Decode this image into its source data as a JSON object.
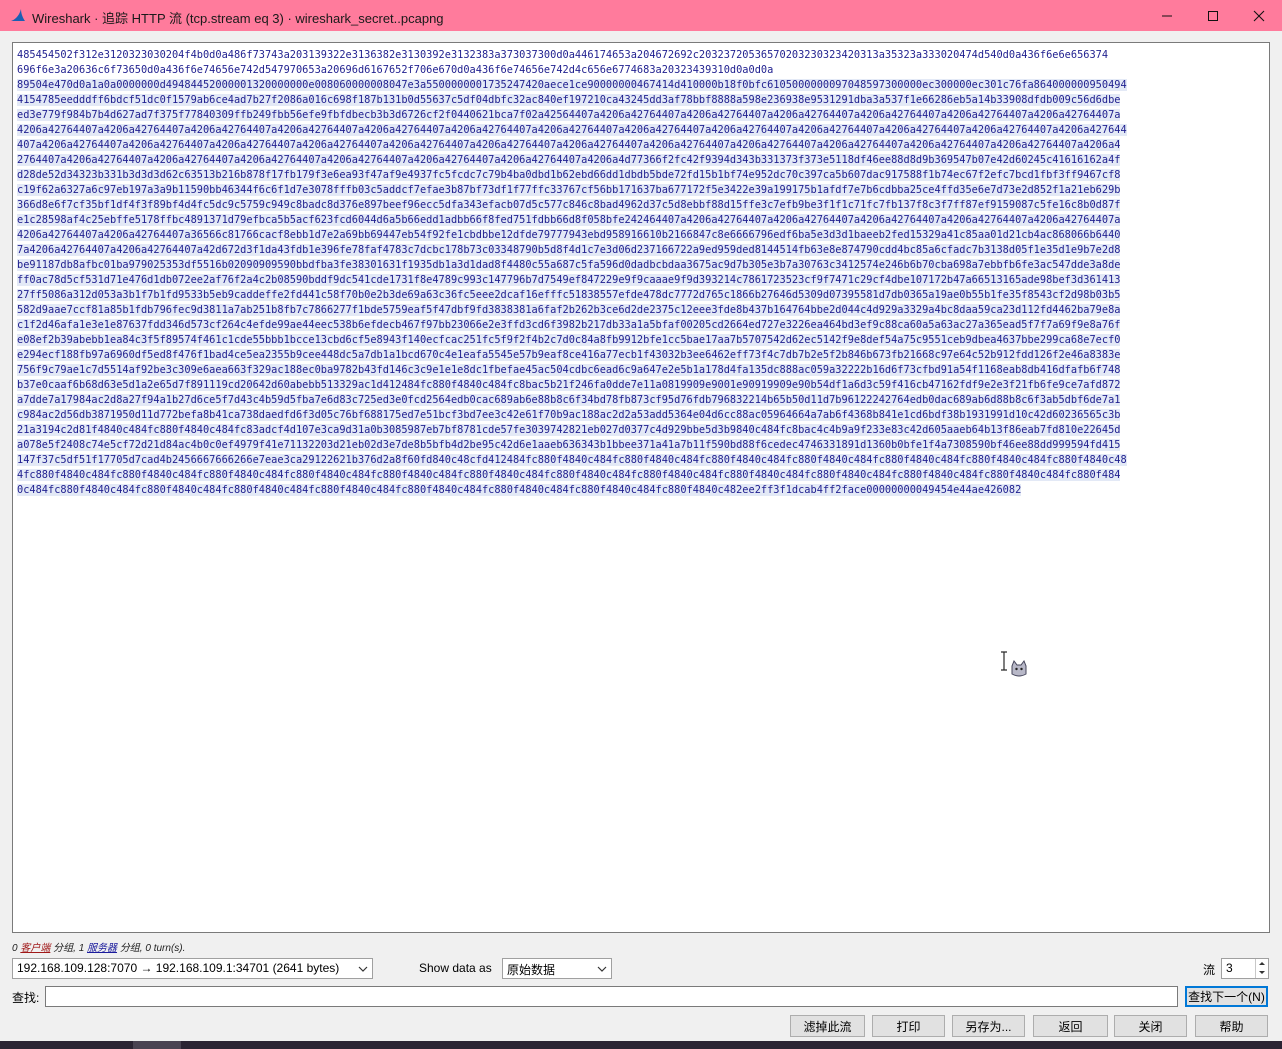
{
  "window": {
    "title": "Wireshark · 追踪 HTTP 流 (tcp.stream eq 3) · wireshark_secret..pcapng"
  },
  "stream": {
    "lines": [
      {
        "text": "485454502f312e3120323030204f4b0d0a486f73743a203139322e3136382e3130392e3132383a373037300d0a446174653a204672692c20323720536570203230323420313a35323a333020474d540d0a436f6e6e656374",
        "hl": false
      },
      {
        "text": "696f6e3a20636c6f73650d0a436f6e74656e742d547970653a20696d6167652f706e670d0a436f6e74656e742d4c656e6774683a20323439310d0a0d0a",
        "hl": false
      },
      {
        "text": "89504e470d0a1a0a0000000d49484452000001320000000e008060000008047e3a5500000001735247420aece1ce90000000467414d410000b18f0bfc6105000000097048597300000ec300000ec301c76fa864000000950494",
        "hl": true
      },
      {
        "text": "4154785eedddff6bdcf51dc0f1579ab6ce4ad7b27f2086a016c698f187b131b0d55637c5df04dbfc32ac840ef197210ca43245dd3af78bbf8888a598e236938e9531291dba3a537f1e66286eb5a14b33908dfdb009c56d6dbe",
        "hl": true
      },
      {
        "text": "ed3e779f984b7b4d627ad7f375f77840309ffb249fbb56efe9fbfdbecb3b3d6726cf2f0440621bca7f02a42564407a4206a42764407a4206a42764407a4206a42764407a4206a42764407a4206a42764407a4206a42764407a",
        "hl": true
      },
      {
        "text": "4206a42764407a4206a42764407a4206a42764407a4206a42764407a4206a42764407a4206a42764407a4206a42764407a4206a42764407a4206a42764407a4206a42764407a4206a42764407a4206a42764407a4206a427644",
        "hl": true
      },
      {
        "text": "407a4206a42764407a4206a42764407a4206a42764407a4206a42764407a4206a42764407a4206a42764407a4206a42764407a4206a42764407a4206a42764407a4206a42764407a4206a42764407a4206a42764407a4206a4",
        "hl": true
      },
      {
        "text": "2764407a4206a42764407a4206a42764407a4206a42764407a4206a42764407a4206a42764407a4206a42764407a4206a4d77366f2fc42f9394d343b331373f373e5118df46ee88d8d9b369547b07e42d60245c41616162a4f",
        "hl": true
      },
      {
        "text": "d28de52d34323b331b3d3d3d62c63513b216b878f17fb179f3e6ea93f47af9e4937fc5fcdc7c79b4ba0dbd1b62ebd66dd1dbdb5bde72fd15b1bf74e952dc70c397ca5b607dac917588f1b74ec67f2efc7bcd1fbf3ff9467cf8",
        "hl": true
      },
      {
        "text": "c19f62a6327a6c97eb197a3a9b11590bb46344f6c6f1d7e3078fffb03c5addcf7efae3b87bf73df1f77ffc33767cf56bb171637ba677172f5e3422e39a199175b1afdf7e7b6cdbba25ce4ffd35e6e7d73e2d852f1a21eb629b",
        "hl": true
      },
      {
        "text": "366d8e6f7cf35bf1df4f3f89bf4d4fc5dc9c5759c949c8badc8d376e897beef96ecc5dfa343efacb07d5c577c846c8bad4962d37c5d8ebbf88d15ffe3c7efb9be3f1f1c71fc7fb137f8c3f7ff87ef9159087c5fe16c8b0d87f",
        "hl": true
      },
      {
        "text": "e1c28598af4c25ebffe5178ffbc4891371d79efbca5b5acf623fcd6044d6a5b66edd1adbb66f8fed751fdbb66d8f058bfe242464407a4206a42764407a4206a42764407a4206a42764407a4206a42764407a4206a42764407a",
        "hl": true
      },
      {
        "text": "4206a42764407a4206a42764407a36566c81766cacf8ebb1d7e2a69bb69447eb54f92fe1cbdbbe12dfde79777943ebd958916610b2166847c8e6666796edf6ba5e3d3d1baeeb2fed15329a41c85aa01d21cb4ac868066b6440",
        "hl": true
      },
      {
        "text": "7a4206a42764407a4206a42764407a42d672d3f1da43fdb1e396fe78faf4783c7dcbc178b73c03348790b5d8f4d1c7e3d06d237166722a9ed959ded8144514fb63e8e874790cdd4bc85a6cfadc7b3138d05f1e35d1e9b7e2d8",
        "hl": true
      },
      {
        "text": "be91187db8afbc01ba979025353df5516b02090909590bbdfba3fe38301631f1935db1a3d1dad8f4480c55a687c5fa596d0dadbcbdaa3675ac9d7b305e3b7a30763c3412574e246b6b70cba698a7ebbfb6fe3ac547dde3a8de",
        "hl": true
      },
      {
        "text": "ff0ac78d5cf531d71e476d1db072ee2af76f2a4c2b08590bddf9dc541cde1731f8e4789c993c147796b7d7549ef847229e9f9caaae9f9d393214c7861723523cf9f7471c29cf4dbe107172b47a66513165ade98bef3d361413",
        "hl": true
      },
      {
        "text": "27ff5086a312d053a3b1f7b1fd9533b5eb9caddeffe2fd441c58f70b0e2b3de69a63c36fc5eee2dcaf16efffc51838557efde478dc7772d765c1866b27646d5309d07395581d7db0365a19ae0b55b1fe35f8543cf2d98b03b5",
        "hl": true
      },
      {
        "text": "582d9aae7ccf81a85b1fdb796fec9d3811a7ab251b8fb7c7866277f1bde5759eaf5f47dbf9fd3838381a6faf2b262b3ce6d2de2375c12eee3fde8b437b164764bbe2d044c4d929a3329a4bc8daa59ca23d112fd4462ba79e8a",
        "hl": true
      },
      {
        "text": "c1f2d46afa1e3e1e87637fdd346d573cf264c4efde99ae44eec538b6efdecb467f97bb23066e2e3ffd3cd6f3982b217db33a1a5bfaf00205cd2664ed727e3226ea464bd3ef9c88ca60a5a63ac27a365ead5f7f7a69f9e8a76f",
        "hl": true
      },
      {
        "text": "e08ef2b39abebb1ea84c3f5f89574f461c1cde55bbb1bcce13cbd6cf5e8943f140ecfcac251fc5f9f2f4b2c7d0c84a8fb9912bfe1cc5bae17aa7b5707542d62ec5142f9e8def54a75c9551ceb9dbea4637bbe299ca68e7ecf0",
        "hl": true
      },
      {
        "text": "e294ecf188fb97a6960df5ed8f476f1bad4ce5ea2355b9cee448dc5a7db1a1bcd670c4e1eafa5545e57b9eaf8ce416a77ecb1f43032b3ee6462eff73f4c7db7b2e5f2b846b673fb21668c97e64c52b912fdd126f2e46a8383e",
        "hl": true
      },
      {
        "text": "756f9c79ae1c7d5514af92be3c309e6aea663f329ac188ec0ba9782b43fd146c3c9e1e1e8dc1fbefae45ac504cdbc6ead6c9a647e2e5b1a178d4fa135dc888ac059a32222b16d6f73cfbd91a54f1168eab8db416dfafb6f748",
        "hl": true
      },
      {
        "text": "b37e0caaf6b68d63e5d1a2e65d7f891119cd20642d60abebb513329ac1d412484fc880f4840c484fc8bac5b21f246fa0dde7e11a0819909e9001e90919909e90b54df1a6d3c59f416cb47162fdf9e2e3f21fb6fe9ce7afd872",
        "hl": true
      },
      {
        "text": "a7dde7a17984ac2d8a27f94a1b27d6ce5f7d43c4b59d5fba7e6d83c725ed3e0fcd2564edb0cac689ab6e88b8c6f34bd78fb873cf95d76fdb796832214b65b50d11d7b96122242764edb0dac689ab6d88b8c6f3ab5dbf6de7a1",
        "hl": true
      },
      {
        "text": "c984ac2d56db3871950d11d772befa8b41ca738daedfd6f3d05c76bf688175ed7e51bcf3bd7ee3c42e61f70b9ac188ac2d2a53add5364e04d6cc88ac05964664a7ab6f4368b841e1cd6bdf38b1931991d10c42d60236565c3b",
        "hl": true
      },
      {
        "text": "21a3194c2d81f4840c484fc880f4840c484fc83adcf4d107e3ca9d31a0b3085987eb7bf8781cde57fe3039742821eb027d0377c4d929bbe5d3b9840c484fc8bac4c4b9a9f233e83c42d605aaeb64b13f86eab7fd810e22645d",
        "hl": true
      },
      {
        "text": "a078e5f2408c74e5cf72d21d84ac4b0c0ef4979f41e71132203d21eb02d3e7de8b5bfb4d2be95c42d6e1aaeb636343b1bbee371a41a7b11f590bd88f6cedec4746331891d1360b0bfe1f4a7308590bf46ee88dd999594fd415",
        "hl": true
      },
      {
        "text": "147f37c5df51f17705d7cad4b2456667666266e7eae3ca29122621b376d2a8f60fd840c48cfd412484fc880f4840c484fc880f4840c484fc880f4840c484fc880f4840c484fc880f4840c484fc880f4840c484fc880f4840c48",
        "hl": true
      },
      {
        "text": "4fc880f4840c484fc880f4840c484fc880f4840c484fc880f4840c484fc880f4840c484fc880f4840c484fc880f4840c484fc880f4840c484fc880f4840c484fc880f4840c484fc880f4840c484fc880f4840c484fc880f484",
        "hl": true
      },
      {
        "text": "0c484fc880f4840c484fc880f4840c484fc880f4840c484fc880f4840c484fc880f4840c484fc880f4840c484fc880f4840c484fc880f4840c482ee2ff3f1dcab4ff2face00000000049454e44ae426082",
        "hl": true
      }
    ]
  },
  "summary": {
    "client_count": "0",
    "client_label": "客户端",
    "packets_word_1": "分组,",
    "server_count": "1",
    "server_label": "服务器",
    "packets_word_2": "分组,",
    "turns": "0 turn(s)."
  },
  "controls": {
    "conversation": "192.168.109.128:7070 → 192.168.109.1:34701 (2641 bytes)",
    "show_data_as_label": "Show data as",
    "format": "原始数据",
    "flow_label": "流",
    "flow_value": "3",
    "find_label": "查找:",
    "find_value": "",
    "find_next": "查找下一个(N)"
  },
  "buttons": {
    "filter_out": "滤掉此流",
    "print": "打印",
    "save_as": "另存为...",
    "back": "返回",
    "close": "关闭",
    "help": "帮助"
  },
  "colors": {
    "titlebar": "#ff7b9c",
    "stream_text": "#1f1f8f",
    "selection": "#e3e9f6",
    "focus_border": "#0078d7"
  }
}
